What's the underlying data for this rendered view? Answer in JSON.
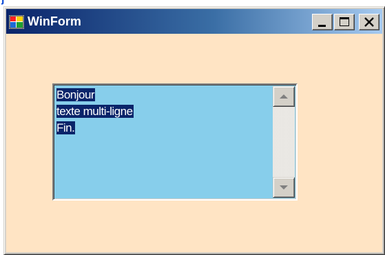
{
  "window": {
    "title": "WinForm",
    "icon": "winform-app-icon",
    "caption_buttons": [
      "minimize-icon",
      "maximize-icon",
      "close-icon"
    ],
    "client_background": "#ffe4c4"
  },
  "textbox": {
    "background": "#87ceeb",
    "lines": [
      "Bonjour",
      "texte multi-ligne",
      "Fin."
    ],
    "selected": true,
    "selection_color": "#0a246a",
    "scrollbar": {
      "up_icon": "arrow-up-icon",
      "down_icon": "arrow-down-icon"
    }
  },
  "colors": {
    "title_gradient_start": "#0a246a",
    "title_gradient_end": "#a6caf0",
    "chrome": "#d4d0c8"
  }
}
